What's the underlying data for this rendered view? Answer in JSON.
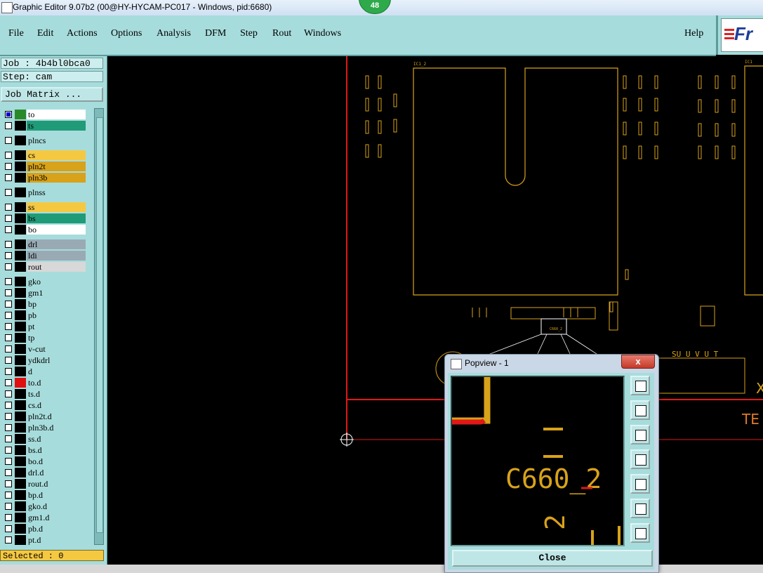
{
  "window": {
    "title": "Graphic Editor 9.07b2 (00@HY-HYCAM-PC017 - Windows, pid:6680)",
    "badge": "48"
  },
  "menu": {
    "items": [
      "File",
      "Edit",
      "Actions",
      "Options",
      "Analysis",
      "DFM",
      "Step",
      "Rout",
      "Windows"
    ],
    "help": "Help",
    "logo_text": "Fr"
  },
  "job": {
    "job_label": "Job : 4b4bl0bca0",
    "step_label": "Step: cam",
    "matrix_button": "Job Matrix ..."
  },
  "layers": [
    {
      "name": "to",
      "color": "#ffffff",
      "bg": "#ffffff",
      "swatch": "#2a8a2a",
      "checked": true
    },
    {
      "name": "ts",
      "color": "#000000",
      "bg": "#1f9b78",
      "swatch": "#000000",
      "checked": false
    },
    {
      "name": "plncs",
      "color": "#000000",
      "bg": "#a7dcdc",
      "swatch": "#000000",
      "checked": false
    },
    {
      "name": "cs",
      "color": "#000000",
      "bg": "#f5c842",
      "swatch": "#000000",
      "checked": false
    },
    {
      "name": "pln2t",
      "color": "#000000",
      "bg": "#d8a21a",
      "swatch": "#000000",
      "checked": false
    },
    {
      "name": "pln3b",
      "color": "#000000",
      "bg": "#d8a21a",
      "swatch": "#000000",
      "checked": false
    },
    {
      "name": "plnss",
      "color": "#000000",
      "bg": "#a7dcdc",
      "swatch": "#000000",
      "checked": false
    },
    {
      "name": "ss",
      "color": "#000000",
      "bg": "#f5c842",
      "swatch": "#000000",
      "checked": false
    },
    {
      "name": "bs",
      "color": "#000000",
      "bg": "#1f9b78",
      "swatch": "#000000",
      "checked": false
    },
    {
      "name": "bo",
      "color": "#000000",
      "bg": "#ffffff",
      "swatch": "#000000",
      "checked": false
    },
    {
      "name": "drl",
      "color": "#000000",
      "bg": "#9aaab5",
      "swatch": "#000000",
      "checked": false
    },
    {
      "name": "ldi",
      "color": "#000000",
      "bg": "#9aaab5",
      "swatch": "#000000",
      "checked": false
    },
    {
      "name": "rout",
      "color": "#000000",
      "bg": "#d8d8d8",
      "swatch": "#000000",
      "checked": false
    },
    {
      "name": "gko",
      "color": "#000000",
      "bg": "#a7dcdc",
      "swatch": "#000000",
      "checked": false
    },
    {
      "name": "gm1",
      "color": "#000000",
      "bg": "#a7dcdc",
      "swatch": "#000000",
      "checked": false
    },
    {
      "name": "bp",
      "color": "#000000",
      "bg": "#a7dcdc",
      "swatch": "#000000",
      "checked": false
    },
    {
      "name": "pb",
      "color": "#000000",
      "bg": "#a7dcdc",
      "swatch": "#000000",
      "checked": false
    },
    {
      "name": "pt",
      "color": "#000000",
      "bg": "#a7dcdc",
      "swatch": "#000000",
      "checked": false
    },
    {
      "name": "tp",
      "color": "#000000",
      "bg": "#a7dcdc",
      "swatch": "#000000",
      "checked": false
    },
    {
      "name": "v-cut",
      "color": "#000000",
      "bg": "#a7dcdc",
      "swatch": "#000000",
      "checked": false
    },
    {
      "name": "ydkdrl",
      "color": "#000000",
      "bg": "#a7dcdc",
      "swatch": "#000000",
      "checked": false
    },
    {
      "name": "d",
      "color": "#000000",
      "bg": "#a7dcdc",
      "swatch": "#000000",
      "checked": false
    },
    {
      "name": "to.d",
      "color": "#000000",
      "bg": "#a7dcdc",
      "swatch": "#e01010",
      "checked": false
    },
    {
      "name": "ts.d",
      "color": "#000000",
      "bg": "#a7dcdc",
      "swatch": "#000000",
      "checked": false
    },
    {
      "name": "cs.d",
      "color": "#000000",
      "bg": "#a7dcdc",
      "swatch": "#000000",
      "checked": false
    },
    {
      "name": "pln2t.d",
      "color": "#000000",
      "bg": "#a7dcdc",
      "swatch": "#000000",
      "checked": false
    },
    {
      "name": "pln3b.d",
      "color": "#000000",
      "bg": "#a7dcdc",
      "swatch": "#000000",
      "checked": false
    },
    {
      "name": "ss.d",
      "color": "#000000",
      "bg": "#a7dcdc",
      "swatch": "#000000",
      "checked": false
    },
    {
      "name": "bs.d",
      "color": "#000000",
      "bg": "#a7dcdc",
      "swatch": "#000000",
      "checked": false
    },
    {
      "name": "bo.d",
      "color": "#000000",
      "bg": "#a7dcdc",
      "swatch": "#000000",
      "checked": false
    },
    {
      "name": "drl.d",
      "color": "#000000",
      "bg": "#a7dcdc",
      "swatch": "#000000",
      "checked": false
    },
    {
      "name": "rout.d",
      "color": "#000000",
      "bg": "#a7dcdc",
      "swatch": "#000000",
      "checked": false
    },
    {
      "name": "bp.d",
      "color": "#000000",
      "bg": "#a7dcdc",
      "swatch": "#000000",
      "checked": false
    },
    {
      "name": "gko.d",
      "color": "#000000",
      "bg": "#a7dcdc",
      "swatch": "#000000",
      "checked": false
    },
    {
      "name": "gm1.d",
      "color": "#000000",
      "bg": "#a7dcdc",
      "swatch": "#000000",
      "checked": false
    },
    {
      "name": "pb.d",
      "color": "#000000",
      "bg": "#a7dcdc",
      "swatch": "#000000",
      "checked": false
    },
    {
      "name": "pt.d",
      "color": "#000000",
      "bg": "#a7dcdc",
      "swatch": "#000000",
      "checked": false
    }
  ],
  "status": {
    "selected": "Selected : 0"
  },
  "canvas": {
    "labels": {
      "ic1": "IC1_2",
      "ic_right": "IC1",
      "te": "TE",
      "x": "X",
      "suvut": "SU U V U T",
      "c660_small": "C660_2"
    },
    "colors": {
      "outline": "#d8a21a",
      "red": "#e01818",
      "white": "#ffffff"
    }
  },
  "popview": {
    "title": "Popview - 1",
    "close_x": "x",
    "label": "C660_2",
    "label2": "2",
    "close": "Close",
    "tools": [
      "zoom-fit-icon",
      "arrow-up-icon",
      "arrow-down-icon",
      "arrow-left-icon",
      "arrow-right-icon",
      "zoom-out-icon",
      "pan-icon"
    ]
  }
}
